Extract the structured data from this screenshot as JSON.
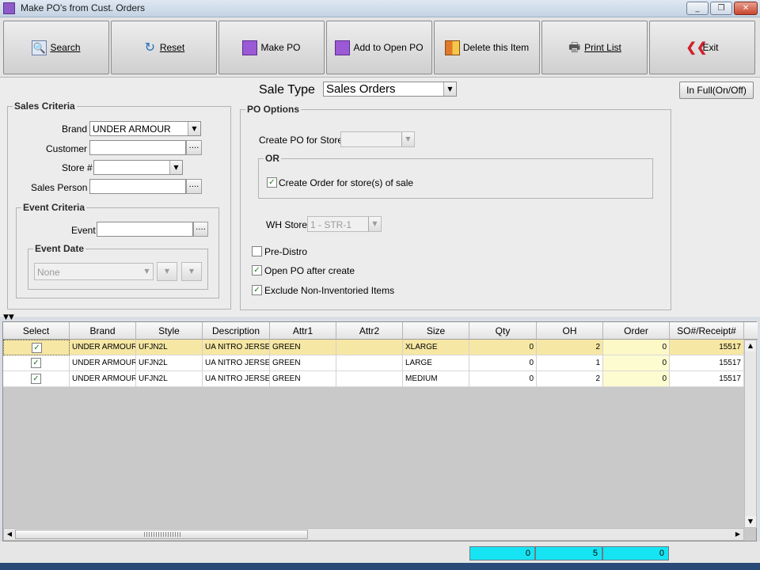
{
  "window": {
    "title": "Make PO's from Cust. Orders",
    "controls": [
      "_",
      "❐",
      "✕"
    ]
  },
  "toolbar": {
    "buttons": [
      {
        "label": "Search",
        "icon": "search-icon"
      },
      {
        "label": "Reset",
        "icon": "refresh-icon"
      },
      {
        "label": "Make PO",
        "icon": "document-icon"
      },
      {
        "label": "Add to Open PO",
        "icon": "document-add-icon"
      },
      {
        "label": "Delete this Item",
        "icon": "grid-icon"
      },
      {
        "label": "Print List",
        "icon": "printer-icon"
      },
      {
        "label": "Exit",
        "icon": "exit-arrow-icon"
      }
    ]
  },
  "sale_type": {
    "label": "Sale Type",
    "value": "Sales Orders"
  },
  "in_full_button": "In Full(On/Off)",
  "sales_criteria": {
    "legend": "Sales Criteria",
    "brand_label": "Brand",
    "brand_value": "UNDER ARMOUR",
    "customer_label": "Customer",
    "customer_value": "",
    "store_label": "Store #",
    "store_value": "",
    "sales_person_label": "Sales Person",
    "sales_person_value": "",
    "ellipsis": "...."
  },
  "event_criteria": {
    "legend": "Event Criteria",
    "event_label": "Event",
    "event_value": "",
    "event_date_legend": "Event Date",
    "event_date_value": "None"
  },
  "po_options": {
    "legend": "PO Options",
    "create_po_label": "Create PO for Store",
    "create_po_value": "",
    "or_legend": "OR",
    "create_order_label": "Create Order for store(s) of sale",
    "create_order_checked": true,
    "wh_store_label": "WH Store",
    "wh_store_value": "1 - STR-1",
    "pre_distro_label": "Pre-Distro",
    "pre_distro_checked": false,
    "open_po_label": "Open PO after create",
    "open_po_checked": true,
    "exclude_label": "Exclude Non-Inventoried Items",
    "exclude_checked": true
  },
  "grid": {
    "columns": [
      "Select",
      "Brand",
      "Style",
      "Description",
      "Attr1",
      "Attr2",
      "Size",
      "Qty",
      "OH",
      "Order",
      "SO#/Receipt#"
    ],
    "rows": [
      {
        "select": true,
        "brand": "UNDER ARMOUR",
        "style": "UFJN2L",
        "description": "UA NITRO JERSEY",
        "attr1": "GREEN",
        "attr2": "",
        "size": "XLARGE",
        "qty": "0",
        "oh": "2",
        "order": "0",
        "so": "15517"
      },
      {
        "select": true,
        "brand": "UNDER ARMOUR",
        "style": "UFJN2L",
        "description": "UA NITRO JERSEY",
        "attr1": "GREEN",
        "attr2": "",
        "size": "LARGE",
        "qty": "0",
        "oh": "1",
        "order": "0",
        "so": "15517"
      },
      {
        "select": true,
        "brand": "UNDER ARMOUR",
        "style": "UFJN2L",
        "description": "UA NITRO JERSEY",
        "attr1": "GREEN",
        "attr2": "",
        "size": "MEDIUM",
        "qty": "0",
        "oh": "2",
        "order": "0",
        "so": "15517"
      }
    ]
  },
  "totals": {
    "qty": "0",
    "oh": "5",
    "order": "0"
  },
  "check_glyph": "✓"
}
